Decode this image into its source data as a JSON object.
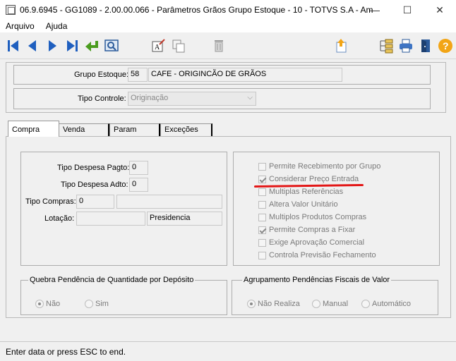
{
  "window": {
    "title": "06.9.6945 - GG1089 - 2.00.00.066 - Parâmetros Grãos Grupo Estoque - 10 - TOTVS S.A - Am...",
    "minimize_glyph": "—",
    "maximize_glyph": "☐",
    "close_glyph": "✕"
  },
  "menu": {
    "items": [
      "Arquivo",
      "Ajuda"
    ]
  },
  "toolbar": {
    "icons": [
      "first-record-icon",
      "previous-record-icon",
      "next-record-icon",
      "last-record-icon",
      "go-to-icon",
      "search-icon",
      "edit-text-icon",
      "copy-icon",
      "delete-icon",
      "export-icon",
      "hierarchy-icon",
      "print-icon",
      "exit-icon",
      "help-icon"
    ]
  },
  "header": {
    "grupo_estoque_label": "Grupo Estoque:",
    "grupo_estoque_code": "58",
    "grupo_estoque_desc": "CAFE - ORIGINCÃO DE GRÃOS",
    "tipo_controle_label": "Tipo Controle:",
    "tipo_controle_value": "Originação"
  },
  "tabs": [
    {
      "label": "Compra",
      "active": true
    },
    {
      "label": "Venda",
      "active": false
    },
    {
      "label": "Param",
      "active": false
    },
    {
      "label": "Exceções",
      "active": false
    }
  ],
  "compra": {
    "tipo_despesa_pagto_label": "Tipo Despesa Pagto:",
    "tipo_despesa_pagto_value": "0",
    "tipo_despesa_adto_label": "Tipo Despesa Adto:",
    "tipo_despesa_adto_value": "0",
    "tipo_compras_label": "Tipo Compras:",
    "tipo_compras_value": "0",
    "tipo_compras_desc": "",
    "lotacao_label": "Lotação:",
    "lotacao_value": "",
    "lotacao_desc": "Presidencia",
    "checkboxes": [
      {
        "label": "Permite Recebimento por Grupo",
        "checked": false
      },
      {
        "label": "Considerar Preço Entrada",
        "checked": true
      },
      {
        "label": "Multiplas Referências",
        "checked": false
      },
      {
        "label": "Altera Valor Unitário",
        "checked": false
      },
      {
        "label": "Multiplos Produtos Compras",
        "checked": false
      },
      {
        "label": "Permite Compras a Fixar",
        "checked": true
      },
      {
        "label": "Exige Aprovação Comercial",
        "checked": false
      },
      {
        "label": "Controla Previsão Fechamento",
        "checked": false
      }
    ],
    "quebra_title": "Quebra Pendência de Quantidade por Depósito",
    "quebra_options": [
      {
        "label": "Não",
        "selected": true
      },
      {
        "label": "Sim",
        "selected": false
      }
    ],
    "agrupamento_title": "Agrupamento Pendências Fiscais de Valor",
    "agrupamento_options": [
      {
        "label": "Não Realiza",
        "selected": true
      },
      {
        "label": "Manual",
        "selected": false
      },
      {
        "label": "Automático",
        "selected": false
      }
    ]
  },
  "status": {
    "text": "Enter data or press ESC to end."
  },
  "colors": {
    "annotation_red": "#e31717",
    "nav_blue": "#1f5fbf",
    "help_orange": "#f2a516"
  }
}
